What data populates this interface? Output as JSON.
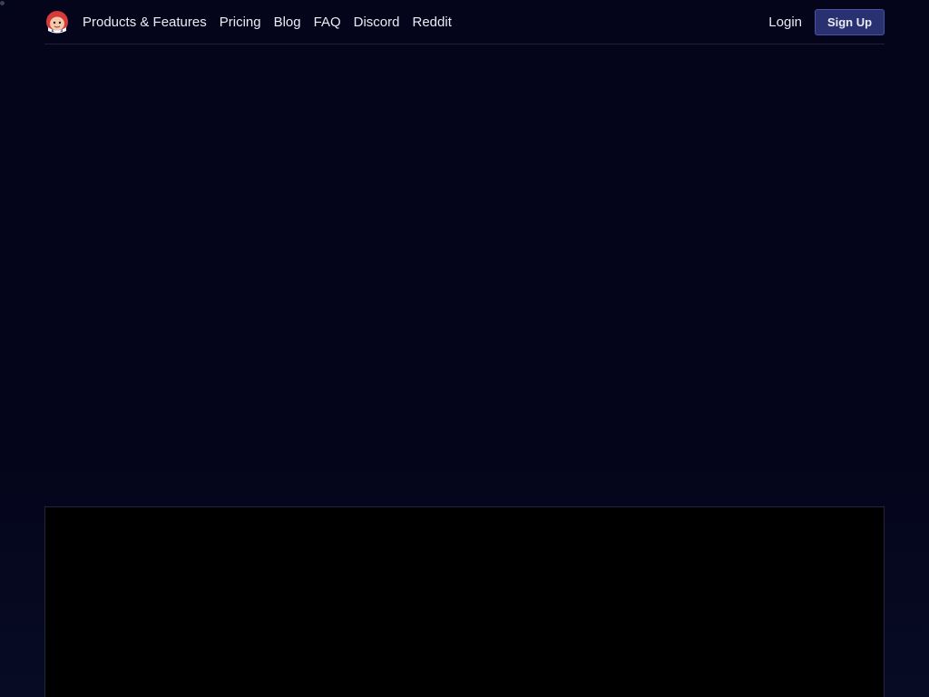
{
  "nav": {
    "logo_icon": "mascot-logo-icon",
    "links": [
      "Products & Features",
      "Pricing",
      "Blog",
      "FAQ",
      "Discord",
      "Reddit"
    ],
    "login_label": "Login",
    "signup_label": "Sign Up"
  },
  "colors": {
    "background": "#04041a",
    "accent": "#2a3170",
    "text": "#e9ebf5"
  }
}
